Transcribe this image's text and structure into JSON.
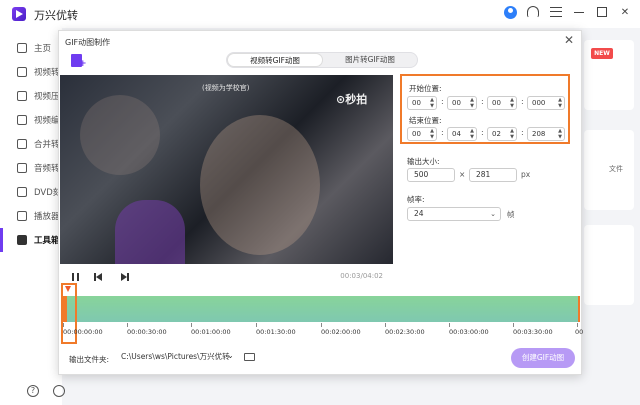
{
  "app": {
    "title": "万兴优转"
  },
  "sidebar": {
    "items": [
      {
        "label": "主页",
        "icon": "home-icon"
      },
      {
        "label": "视频转换",
        "icon": "convert-icon"
      },
      {
        "label": "视频压缩",
        "icon": "compress-icon"
      },
      {
        "label": "视频编辑",
        "icon": "scissors-icon"
      },
      {
        "label": "合并转换",
        "icon": "merge-icon"
      },
      {
        "label": "音频转换",
        "icon": "audio-icon"
      },
      {
        "label": "DVD刻录",
        "icon": "dvd-icon"
      },
      {
        "label": "播放器",
        "icon": "player-icon"
      },
      {
        "label": "工具箱",
        "icon": "toolbox-icon"
      }
    ]
  },
  "background": {
    "badge": "NEW",
    "side_text": "文件"
  },
  "dialog": {
    "title": "GIF动图制作",
    "tabs": [
      "视频转GIF动图",
      "图片转GIF动图"
    ],
    "active_tab": 0,
    "video_caption": "(视频为学校官)",
    "watermark": "⊙秒拍",
    "time": "00:03/04:02",
    "start": {
      "label": "开始位置:",
      "values": [
        "00",
        "00",
        "00",
        "000"
      ]
    },
    "end": {
      "label": "结束位置:",
      "values": [
        "00",
        "04",
        "02",
        "208"
      ]
    },
    "output_size": {
      "label": "输出大小:",
      "width": "500",
      "sep": "×",
      "height": "281",
      "unit": "px"
    },
    "frame_rate": {
      "label": "帧率:",
      "value": "24",
      "unit": "帧"
    },
    "timeline_ticks": [
      "00:00:00:00",
      "00:00:30:00",
      "00:01:00:00",
      "00:01:30:00",
      "00:02:00:00",
      "00:02:30:00",
      "00:03:00:00",
      "00:03:30:00",
      "00"
    ],
    "output_folder": {
      "label": "输出文件夹:",
      "path": "C:\\Users\\ws\\Pictures\\万兴优转"
    },
    "create_button": "创建GIF动图"
  },
  "colors": {
    "accent": "#6f3cf0",
    "highlight": "#f07a2a",
    "timeline": "#88d49a",
    "button": "#b79af5"
  }
}
